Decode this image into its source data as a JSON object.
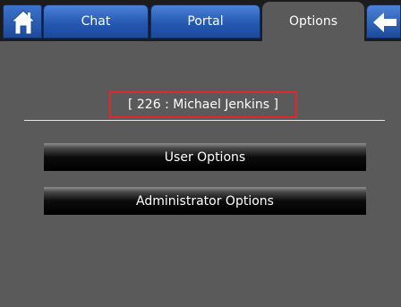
{
  "tabs": [
    {
      "label": "Chat",
      "active": false
    },
    {
      "label": "Portal",
      "active": false
    },
    {
      "label": "Options",
      "active": true
    }
  ],
  "icons": {
    "home": "home-icon",
    "back": "back-arrow-icon"
  },
  "header": {
    "user_label": "[ 226 : Michael Jenkins ]"
  },
  "menu": {
    "user_options": "User Options",
    "admin_options": "Administrator Options"
  },
  "colors": {
    "tab_blue": "#2558b2",
    "background": "#5a5a5a",
    "highlight_border": "#e0282c"
  }
}
